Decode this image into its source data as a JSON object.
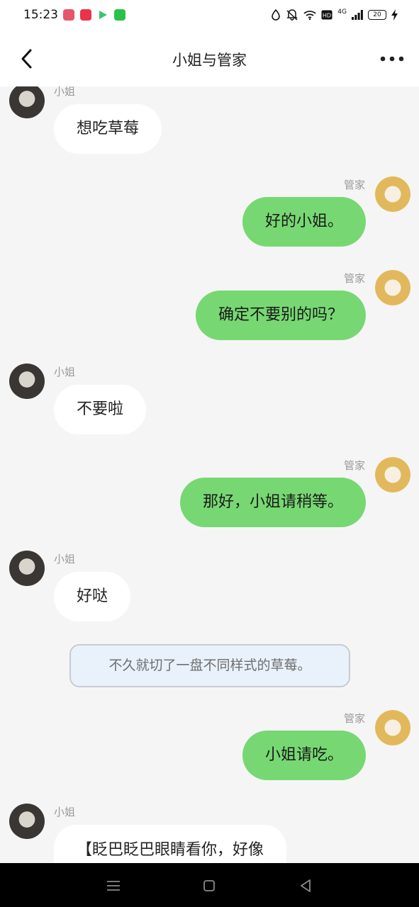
{
  "status_bar": {
    "time": "15:23",
    "network_label": "4G",
    "battery": "20"
  },
  "header": {
    "title": "小姐与管家"
  },
  "messages": [
    {
      "side": "left",
      "name": "小姐",
      "text": "想吃草莓"
    },
    {
      "side": "right",
      "name": "管家",
      "text": "好的小姐。"
    },
    {
      "side": "right",
      "name": "管家",
      "text": "确定不要别的吗？"
    },
    {
      "side": "left",
      "name": "小姐",
      "text": "不要啦"
    },
    {
      "side": "right",
      "name": "管家",
      "text": "那好，小姐请稍等。"
    },
    {
      "side": "left",
      "name": "小姐",
      "text": "好哒"
    },
    {
      "side": "narration",
      "text": "不久就切了一盘不同样式的草莓。"
    },
    {
      "side": "right",
      "name": "管家",
      "text": "小姐请吃。"
    },
    {
      "side": "left",
      "name": "小姐",
      "text": "【眨巴眨巴眼睛看你，好像"
    }
  ],
  "colors": {
    "right_bubble": "#77d873",
    "left_bubble": "#ffffff",
    "chat_background": "#f5f5f5",
    "narration_background": "#e9f1fb"
  }
}
